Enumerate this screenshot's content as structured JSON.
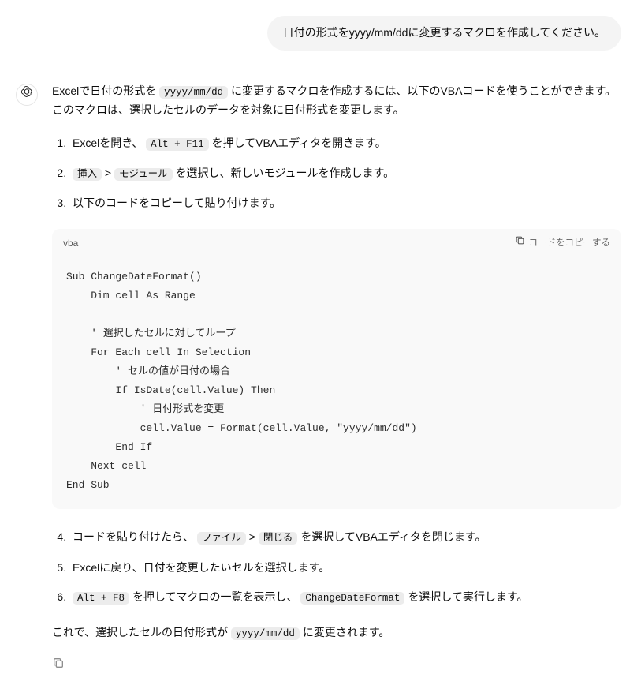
{
  "user": {
    "message": "日付の形式をyyyy/mm/ddに変更するマクロを作成してください。"
  },
  "assistant": {
    "intro_a": "Excelで日付の形式を ",
    "intro_code": "yyyy/mm/dd",
    "intro_b": " に変更するマクロを作成するには、以下のVBAコードを使うことができます。このマクロは、選択したセルのデータを対象に日付形式を変更します。",
    "step1_a": "Excelを開き、 ",
    "step1_code": "Alt + F11",
    "step1_b": " を押してVBAエディタを開きます。",
    "step2_code1": "挿入",
    "step2_sep": " > ",
    "step2_code2": "モジュール",
    "step2_b": " を選択し、新しいモジュールを作成します。",
    "step3": "以下のコードをコピーして貼り付けます。",
    "code_lang": "vba",
    "copy_label": "コードをコピーする",
    "code": "Sub ChangeDateFormat()\n    Dim cell As Range\n\n    ' 選択したセルに対してループ\n    For Each cell In Selection\n        ' セルの値が日付の場合\n        If IsDate(cell.Value) Then\n            ' 日付形式を変更\n            cell.Value = Format(cell.Value, \"yyyy/mm/dd\")\n        End If\n    Next cell\nEnd Sub",
    "step4_a": "コードを貼り付けたら、 ",
    "step4_code1": "ファイル",
    "step4_sep": " > ",
    "step4_code2": "閉じる",
    "step4_b": " を選択してVBAエディタを閉じます。",
    "step5": "Excelに戻り、日付を変更したいセルを選択します。",
    "step6_code1": "Alt + F8",
    "step6_a": " を押してマクロの一覧を表示し、 ",
    "step6_code2": "ChangeDateFormat",
    "step6_b": " を選択して実行します。",
    "outro_a": "これで、選択したセルの日付形式が ",
    "outro_code": "yyyy/mm/dd",
    "outro_b": " に変更されます。"
  }
}
